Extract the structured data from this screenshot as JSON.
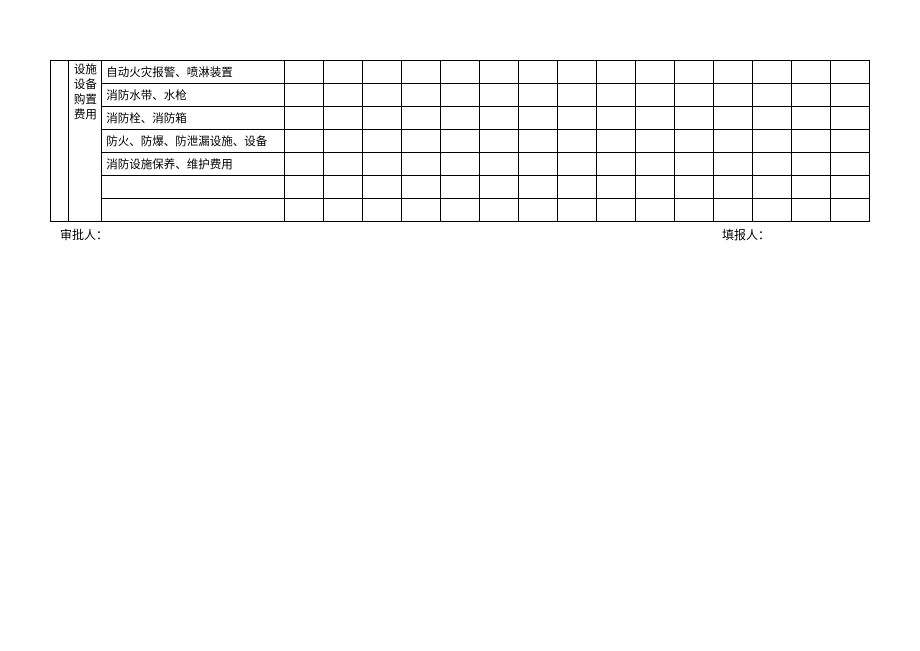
{
  "category": "设施设备购置费用",
  "items": [
    "自动火灾报警、喷淋装置",
    "消防水带、水枪",
    "消防栓、消防箱",
    "防火、防爆、防泄漏设施、设备",
    "消防设施保养、维护费用",
    "",
    ""
  ],
  "footer": {
    "approver_label": "审批人：",
    "reporter_label": "填报人："
  },
  "data_columns": 15
}
